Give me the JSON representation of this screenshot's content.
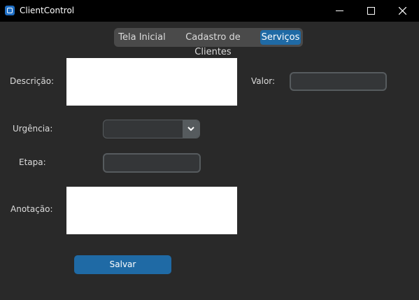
{
  "window": {
    "title": "ClientControl",
    "icon": "app-icon"
  },
  "tabs": [
    {
      "label": "Tela Inicial",
      "selected": false
    },
    {
      "label": "Cadastro de Clientes",
      "selected": false
    },
    {
      "label": "Serviços",
      "selected": true
    }
  ],
  "form": {
    "descricao_label": "Descrição:",
    "descricao_value": "",
    "valor_label": "Valor:",
    "valor_value": "",
    "urgencia_label": "Urgência:",
    "urgencia_value": "",
    "etapa_label": "Etapa:",
    "etapa_value": "",
    "anotacao_label": "Anotação:",
    "anotacao_value": "",
    "save_label": "Salvar"
  },
  "colors": {
    "accent": "#1f6aa5",
    "background": "#292929",
    "titlebar": "#000000"
  }
}
